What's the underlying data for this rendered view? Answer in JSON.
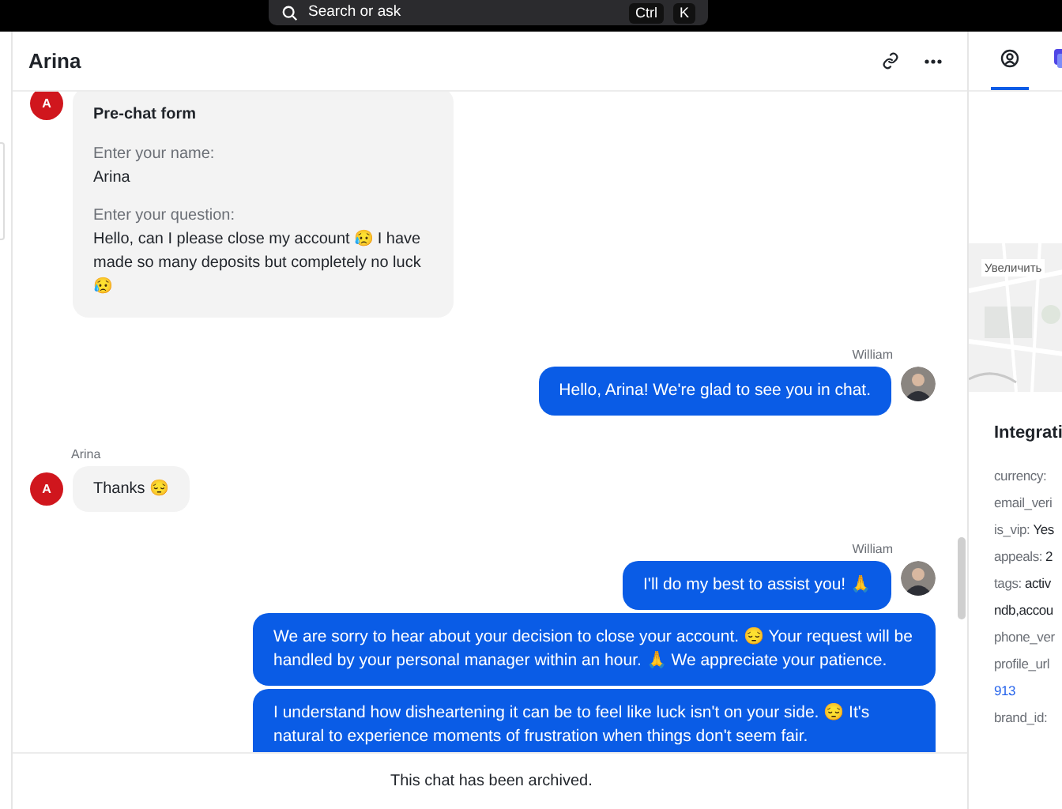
{
  "search": {
    "placeholder": "Search or ask",
    "keys": [
      "Ctrl",
      "K"
    ]
  },
  "header": {
    "title": "Arina"
  },
  "messages": [
    {
      "kind": "form",
      "avatar": "A",
      "title": "Pre-chat form",
      "fields": [
        {
          "label": "Enter your name:",
          "value": "Arina"
        },
        {
          "label": "Enter your question:",
          "value": "Hello, can I please close my account 😥 I have made so many deposits but completely no luck 😥"
        }
      ]
    },
    {
      "kind": "agent",
      "author": "William",
      "texts": [
        "Hello, Arina! We're glad to see you in chat."
      ]
    },
    {
      "kind": "customer",
      "author": "Arina",
      "avatar": "A",
      "texts": [
        "Thanks 😔"
      ]
    },
    {
      "kind": "agent",
      "author": "William",
      "texts": [
        "I'll do my best to assist you! 🙏",
        "We are sorry to hear about your decision to close your account. 😔 Your request will be handled by your personal manager within an hour. 🙏 We appreciate your patience.",
        "I understand how disheartening it can be to feel like luck isn't on your side. 😔 It's natural to experience moments of frustration when things don't seem fair."
      ]
    }
  ],
  "footer": "This chat has been archived.",
  "side_panel": {
    "tabs": [
      {
        "kind": "profile",
        "selected": true
      },
      {
        "kind": "app",
        "selected": false
      }
    ],
    "map_button": "Увеличить",
    "section_title": "Integrati",
    "fields": [
      {
        "key": "currency:"
      },
      {
        "key": "email_veri"
      },
      {
        "key": "is_vip:",
        "value": "Yes"
      },
      {
        "key": "appeals:",
        "value": "2"
      },
      {
        "key": "tags:",
        "value": "activ",
        "value_2": "ndb,accou"
      },
      {
        "key": "phone_ver"
      },
      {
        "key": "profile_url",
        "link": "913"
      },
      {
        "key": "brand_id:"
      }
    ]
  }
}
